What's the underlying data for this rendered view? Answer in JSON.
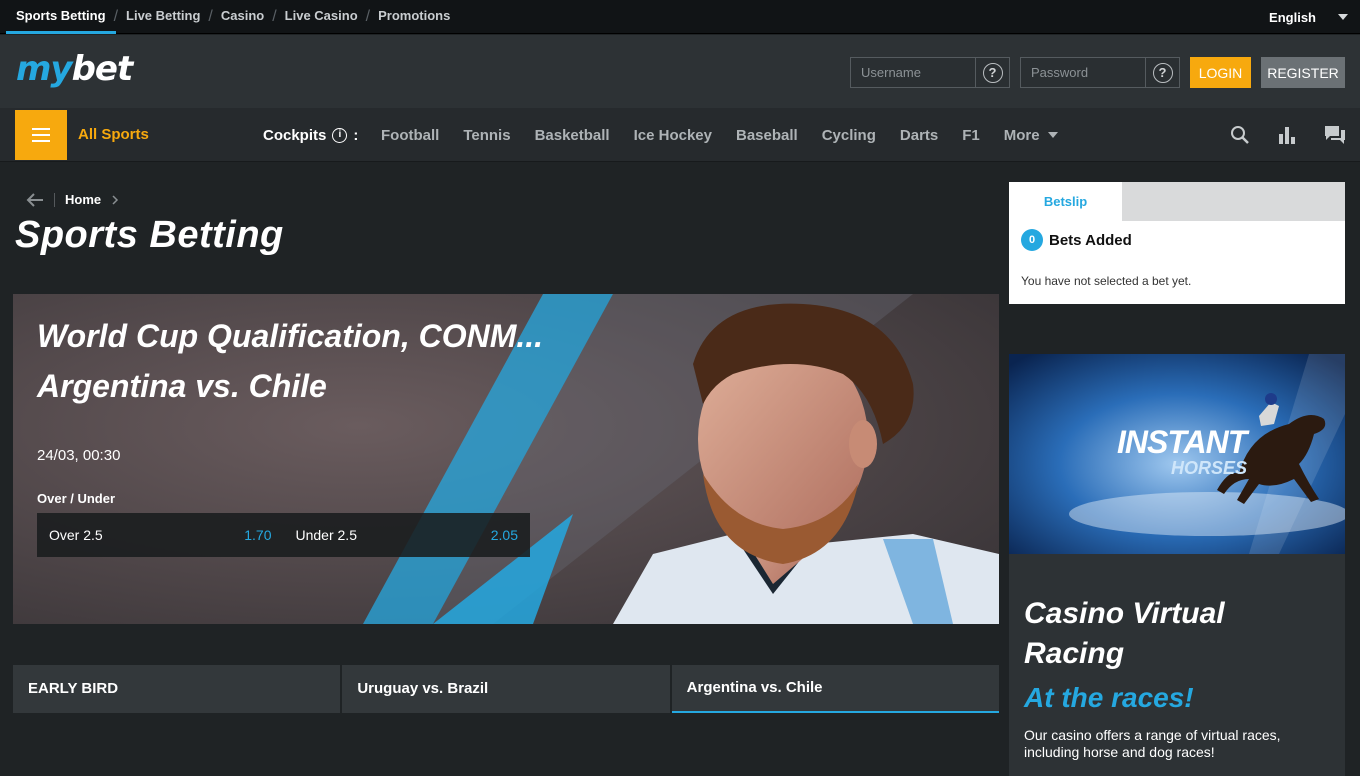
{
  "topnav": {
    "items": [
      "Sports Betting",
      "Live Betting",
      "Casino",
      "Live Casino",
      "Promotions"
    ],
    "language": "English"
  },
  "header": {
    "logo_my": "my",
    "logo_bet": "bet",
    "username_placeholder": "Username",
    "password_placeholder": "Password",
    "help_glyph": "?",
    "login_label": "LOGIN",
    "register_label": "REGISTER"
  },
  "sportsnav": {
    "all_sports": "All Sports",
    "cockpits": "Cockpits",
    "cockpits_info": "i",
    "cockpits_colon": ":",
    "sports": [
      "Football",
      "Tennis",
      "Basketball",
      "Ice Hockey",
      "Baseball",
      "Cycling",
      "Darts",
      "F1"
    ],
    "more": "More"
  },
  "breadcrumb": {
    "home": "Home"
  },
  "page_title": "Sports Betting",
  "hero": {
    "title_line1": "World Cup Qualification, CONM...",
    "title_line2": "Argentina vs. Chile",
    "datetime": "24/03, 00:30",
    "market": "Over / Under",
    "odds": [
      {
        "label": "Over 2.5",
        "price": "1.70"
      },
      {
        "label": "Under 2.5",
        "price": "2.05"
      }
    ]
  },
  "event_tabs": [
    "EARLY BIRD",
    "Uruguay vs. Brazil",
    "Argentina vs. Chile"
  ],
  "betslip": {
    "tab_label": "Betslip",
    "count": "0",
    "count_label": "Bets Added",
    "empty_message": "You have not selected a bet yet."
  },
  "promo": {
    "image_title": "INSTANT",
    "image_subtitle": "HORSES",
    "title": "Casino Virtual Racing",
    "subtitle": "At the races!",
    "description": "Our casino offers a range of virtual races, including horse and dog races!"
  },
  "colors": {
    "accent_blue": "#25a8e0",
    "accent_orange": "#f7a90e",
    "background": "#1f2325"
  }
}
